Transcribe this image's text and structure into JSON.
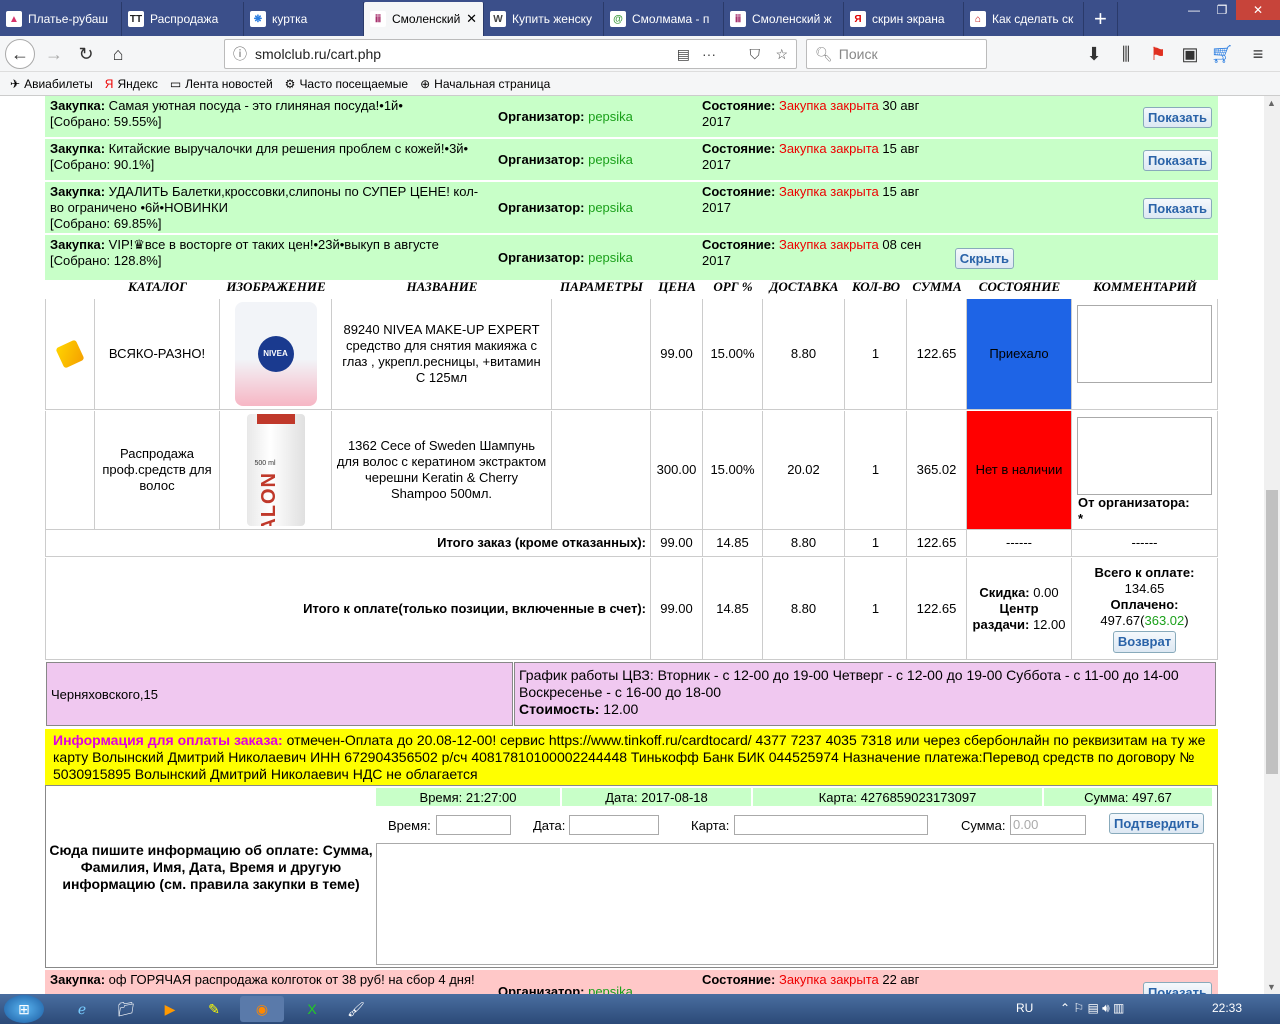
{
  "browser": {
    "tabs": [
      {
        "label": "Платье-рубаш",
        "icon": "dress-icon",
        "color": "#d8336a",
        "glyph": "▲"
      },
      {
        "label": "Распродажа",
        "icon": "tt-icon",
        "color": "#222222",
        "glyph": "TT"
      },
      {
        "label": "куртка",
        "icon": "butterfly-icon",
        "color": "#2a7de1",
        "glyph": "❋"
      },
      {
        "label": "Смоленский",
        "icon": "smolclub-icon",
        "color": "#a02060",
        "glyph": "ⅲ"
      },
      {
        "label": "Купить женску",
        "icon": "wildberries-icon",
        "color": "#444444",
        "glyph": "W"
      },
      {
        "label": "Смолмама - п",
        "icon": "smolmama-icon",
        "color": "#3c9a3c",
        "glyph": "@"
      },
      {
        "label": "Смоленский ж",
        "icon": "smolclub-icon",
        "color": "#a02060",
        "glyph": "ⅲ"
      },
      {
        "label": "скрин экрана",
        "icon": "yandex-icon",
        "color": "#e00000",
        "glyph": "Я"
      },
      {
        "label": "Как сделать ск",
        "icon": "page-icon",
        "color": "#c00000",
        "glyph": "⌂"
      }
    ],
    "new_tab": "+",
    "url": "smolclub.ru/cart.php",
    "search_placeholder": "Поиск",
    "bookmarks": [
      {
        "label": "Авиабилеты",
        "glyph": "✈"
      },
      {
        "label": "Яндекс",
        "glyph": "Я"
      },
      {
        "label": "Лента новостей",
        "glyph": "▭"
      },
      {
        "label": "Часто посещаемые",
        "glyph": "⚙"
      },
      {
        "label": "Начальная страница",
        "glyph": "⊕"
      }
    ]
  },
  "purchases": [
    {
      "label": "Закупка:",
      "title": "Самая уютная посуда - это глиняная посуда!•1й•",
      "collected": "[Собрано: 59.55%]",
      "org_label": "Организатор:",
      "org": "pepsika",
      "state_label": "Состояние:",
      "state": "Закупка закрыта",
      "date1": "30 авг",
      "date2": "2017",
      "button": "Показать"
    },
    {
      "label": "Закупка:",
      "title": "Китайские выручалочки для решения проблем с кожей!•3й•",
      "collected": "[Собрано: 90.1%]",
      "org_label": "Организатор:",
      "org": "pepsika",
      "state_label": "Состояние:",
      "state": "Закупка закрыта",
      "date1": "15 авг",
      "date2": "2017",
      "button": "Показать"
    },
    {
      "label": "Закупка:",
      "title": "УДАЛИТЬ Балетки,кроссовки,слипоны по СУПЕР ЦЕНЕ! кол-во ограничено •6й•НОВИНКИ",
      "collected": "[Собрано: 69.85%]",
      "org_label": "Организатор:",
      "org": "pepsika",
      "state_label": "Состояние:",
      "state": "Закупка закрыта",
      "date1": "15 авг",
      "date2": "2017",
      "button": "Показать"
    },
    {
      "label": "Закупка:",
      "title": "VIP!♛все в восторге от таких цен!•23й•выкуп в августе",
      "collected": "[Собрано: 128.8%]",
      "org_label": "Организатор:",
      "org": "pepsika",
      "state_label": "Состояние:",
      "state": "Закупка закрыта",
      "date1": "08 сен",
      "date2": "2017",
      "button": "Скрыть"
    }
  ],
  "table": {
    "headers": [
      "КАТАЛОГ",
      "ИЗОБРАЖЕНИЕ",
      "НАЗВАНИЕ",
      "ПАРАМЕТРЫ",
      "ЦЕНА",
      "ОРГ %",
      "ДОСТАВКА",
      "КОЛ-ВО",
      "СУММА",
      "СОСТОЯНИЕ",
      "КОММЕНТАРИЙ"
    ],
    "rows": [
      {
        "catalog": "ВСЯКО-РАЗНО!",
        "name": "89240 NIVEA MAKE-UP EXPERT средство для снятия макияжа с глаз , укрепл.ресницы, +витамин С 125мл",
        "params": "",
        "price": "99.00",
        "org": "15.00%",
        "delivery": "8.80",
        "qty": "1",
        "sum": "122.65",
        "state": "Приехало",
        "state_color": "#1e64e6",
        "img_brand": "NIVEA",
        "comment_org": ""
      },
      {
        "catalog": "Распродажа проф.средств для волос",
        "name": "1362 Cece of Sweden Шампунь для волос с кератином экстрактом черешни Keratin & Cherry Shampoo 500мл.",
        "params": "",
        "price": "300.00",
        "org": "15.00%",
        "delivery": "20.02",
        "qty": "1",
        "sum": "365.02",
        "state": "Нет в наличии",
        "state_color": "#ff0000",
        "img_brand": "SALON",
        "img_volume": "500 ml",
        "comment_org_label": "От организатора:",
        "comment_org": "*"
      }
    ],
    "total1": {
      "label": "Итого заказ (кроме отказанных):",
      "price": "99.00",
      "org": "14.85",
      "delivery": "8.80",
      "qty": "1",
      "sum": "122.65",
      "state": "------",
      "comment": "------"
    },
    "total2": {
      "label": "Итого к оплате(только позиции, включенные в счет):",
      "price": "99.00",
      "org": "14.85",
      "delivery": "8.80",
      "qty": "1",
      "sum": "122.65",
      "discount_label": "Скидка:",
      "discount": "0.00",
      "center_label": "Центр раздачи:",
      "center": "12.00",
      "total_label": "Всего к оплате:",
      "total": "134.65",
      "paid_label": "Оплачено:",
      "paid": "497.67",
      "paid_extra": "363.02",
      "refund": "Возврат"
    }
  },
  "cvz": {
    "address": "Черняховского,15",
    "schedule": "График работы ЦВЗ: Вторник - с 12-00 до 19-00 Четверг - с 12-00 до 19-00 Суббота - с 11-00 до 14-00 Воскресенье - с 16-00 до 18-00",
    "cost_label": "Стоимость:",
    "cost": "12.00"
  },
  "payment": {
    "info_label": "Информация для оплаты заказа:",
    "info_text": "отмечен-Оплата до 20.08-12-00! сервис https://www.tinkoff.ru/cardtocard/ 4377 7237 4035 7318 или через сбербонлайн по реквизитам на ту же карту Волынский Дмитрий Николаевич ИНН 672904356502 р/сч 40817810100002244448 Тинькофф Банк БИК 044525974 Назначение платежа:Перевод средств по договору № 5030915895 Волынский Дмитрий Николаевич НДС не облагается",
    "left_note": "Сюда пишите информацию об оплате: Сумма, Фамилия, Имя, Дата, Время и другую информацию (см. правила закупки в теме)",
    "record": {
      "time": "Время: 21:27:00",
      "date": "Дата: 2017-08-18",
      "card": "Карта: 4276859023173097",
      "sum": "Сумма: 497.67"
    },
    "form": {
      "time_label": "Время:",
      "date_label": "Дата:",
      "card_label": "Карта:",
      "sum_label": "Сумма:",
      "sum_placeholder": "0.00",
      "submit": "Подтвердить"
    }
  },
  "next_purchase": {
    "label": "Закупка:",
    "title": "оф ГОРЯЧАЯ распродажа колготок от 38 руб! на сбор 4 дня!",
    "org_label": "Организатор:",
    "org": "pepsika",
    "state_label": "Состояние:",
    "state": "Закупка закрыта",
    "date1": "22 авг",
    "button": "Показать"
  },
  "taskbar": {
    "lang": "RU",
    "time": "22:33"
  }
}
